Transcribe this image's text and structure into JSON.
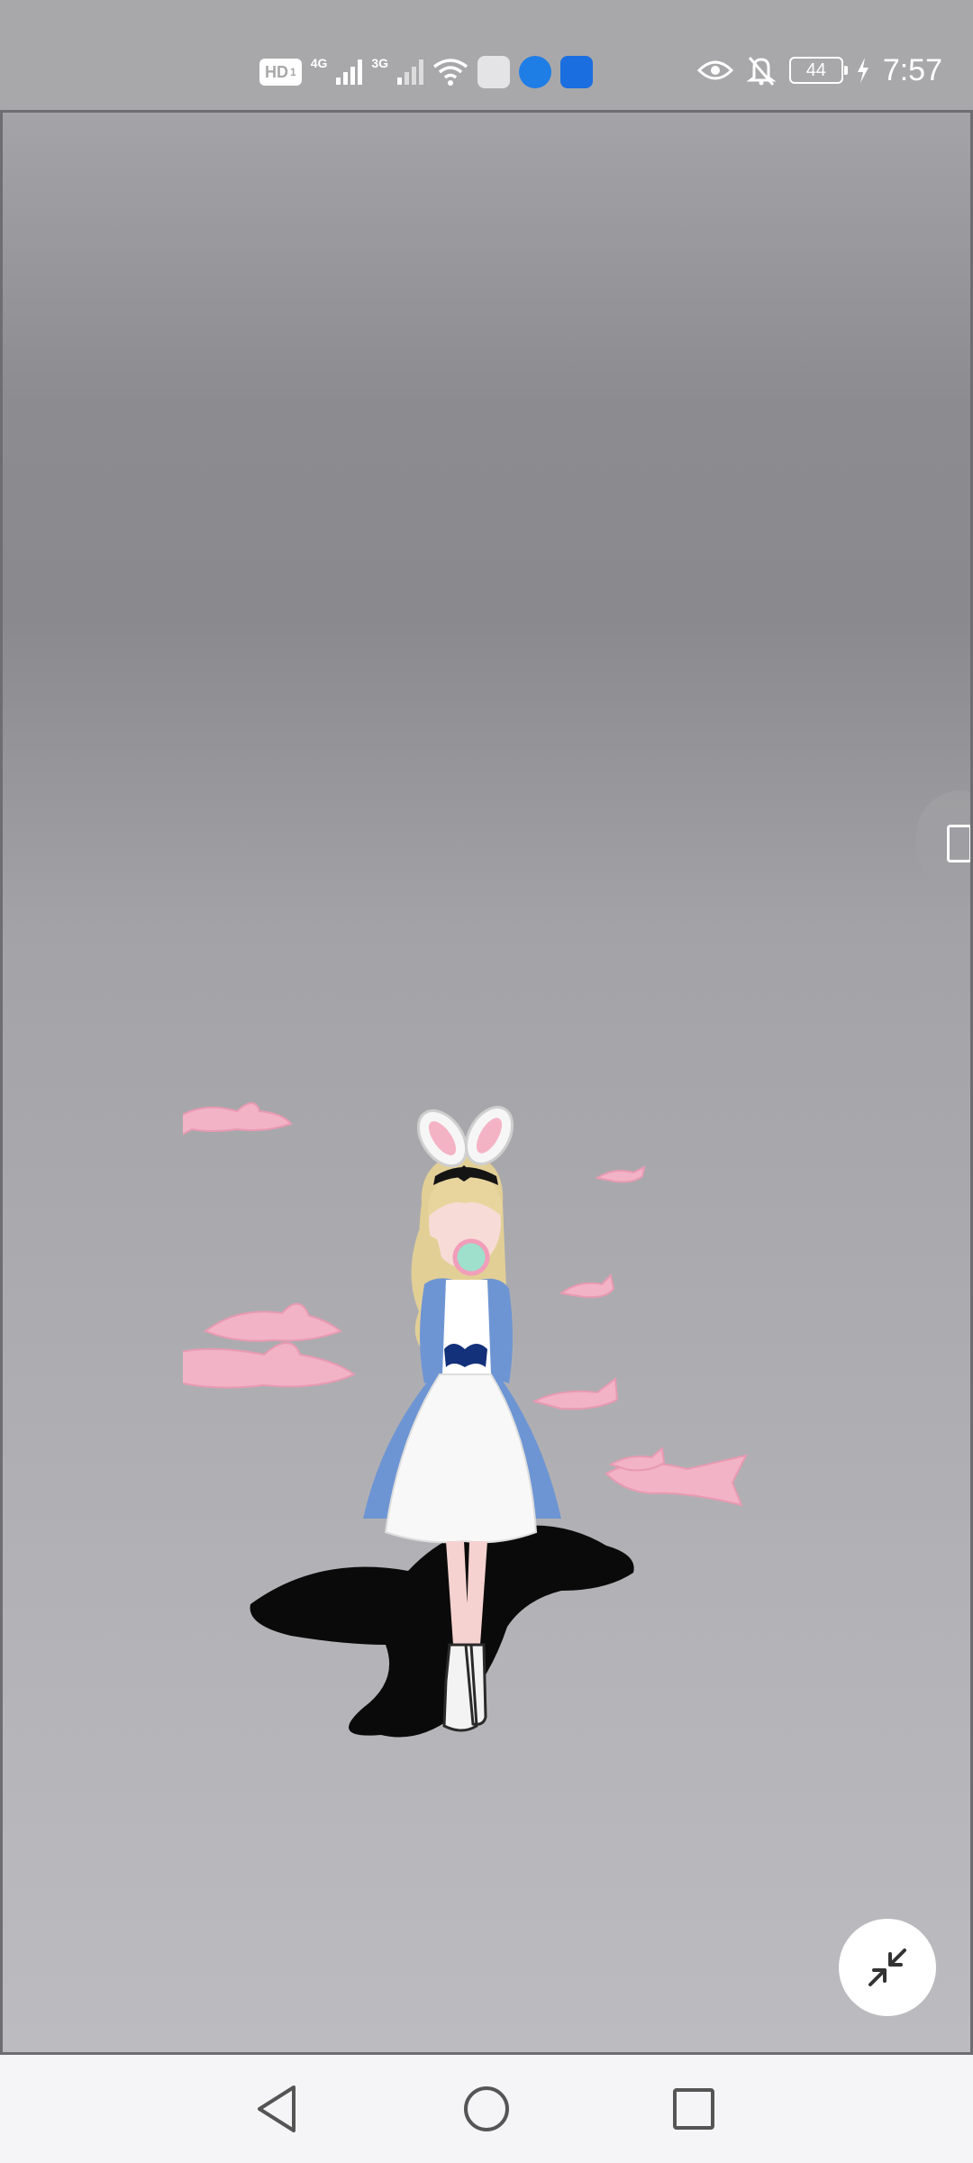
{
  "status_bar": {
    "hd_label": "HD",
    "sim_label": "1",
    "network_1": "4G",
    "network_2": "3G",
    "battery_level": "44",
    "time": "7:57",
    "icons": [
      "hd-icon",
      "signal-4g-icon",
      "signal-3g-icon",
      "wifi-icon",
      "app-icon-grey",
      "app-icon-globe",
      "app-icon-blue",
      "eye-icon",
      "bell-off-icon",
      "battery-icon",
      "charging-icon"
    ]
  },
  "viewer": {
    "content": "3d-avatar",
    "controls": {
      "collapse_icon": "collapse-arrows-icon",
      "side_handle_icon": "side-panel-handle-icon"
    }
  },
  "nav_bar": {
    "buttons": [
      "back-triangle-icon",
      "home-circle-icon",
      "recents-square-icon"
    ]
  },
  "colors": {
    "status_bar_bg": "#a8a8aa",
    "nav_bar_bg": "#f5f5f7",
    "dress_blue": "#6a8fd0",
    "shark_pink": "#f4b6c8",
    "hair_blonde": "#e6d39a"
  }
}
